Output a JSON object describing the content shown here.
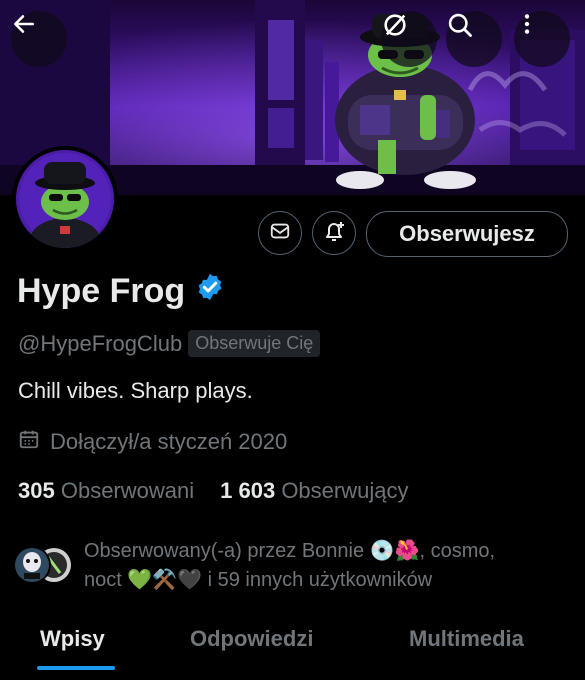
{
  "header": {
    "back_icon": "arrow-left-icon",
    "hide_icon": "circle-slash-icon",
    "search_icon": "search-icon",
    "more_icon": "more-vertical-icon"
  },
  "profile": {
    "display_name": "Hype Frog",
    "verified": true,
    "handle": "@HypeFrogClub",
    "follows_you": "Obserwuje Cię",
    "bio": "Chill vibes. Sharp plays.",
    "joined": "Dołączył/a styczeń 2020",
    "following_count": "305",
    "following_label": "Obserwowani",
    "followers_count": "1 603",
    "followers_label": "Obserwujący"
  },
  "actions": {
    "message_icon": "envelope-icon",
    "notify_icon": "bell-plus-icon",
    "follow_label": "Obserwujesz"
  },
  "followed_by": {
    "line1": "Obserwowany(-a) przez Bonnie 💿🌺, cosmo,",
    "line2": "noct 💚⚒️🖤 i 59 innych użytkowników"
  },
  "tabs": [
    {
      "label": "Wpisy",
      "active": true
    },
    {
      "label": "Odpowiedzi",
      "active": false
    },
    {
      "label": "Multimedia",
      "active": false
    }
  ],
  "colors": {
    "accent": "#1d9bf0",
    "background": "#000000",
    "text": "#e7e9ea",
    "muted": "#71767b",
    "banner_purple": "#3b1280"
  }
}
